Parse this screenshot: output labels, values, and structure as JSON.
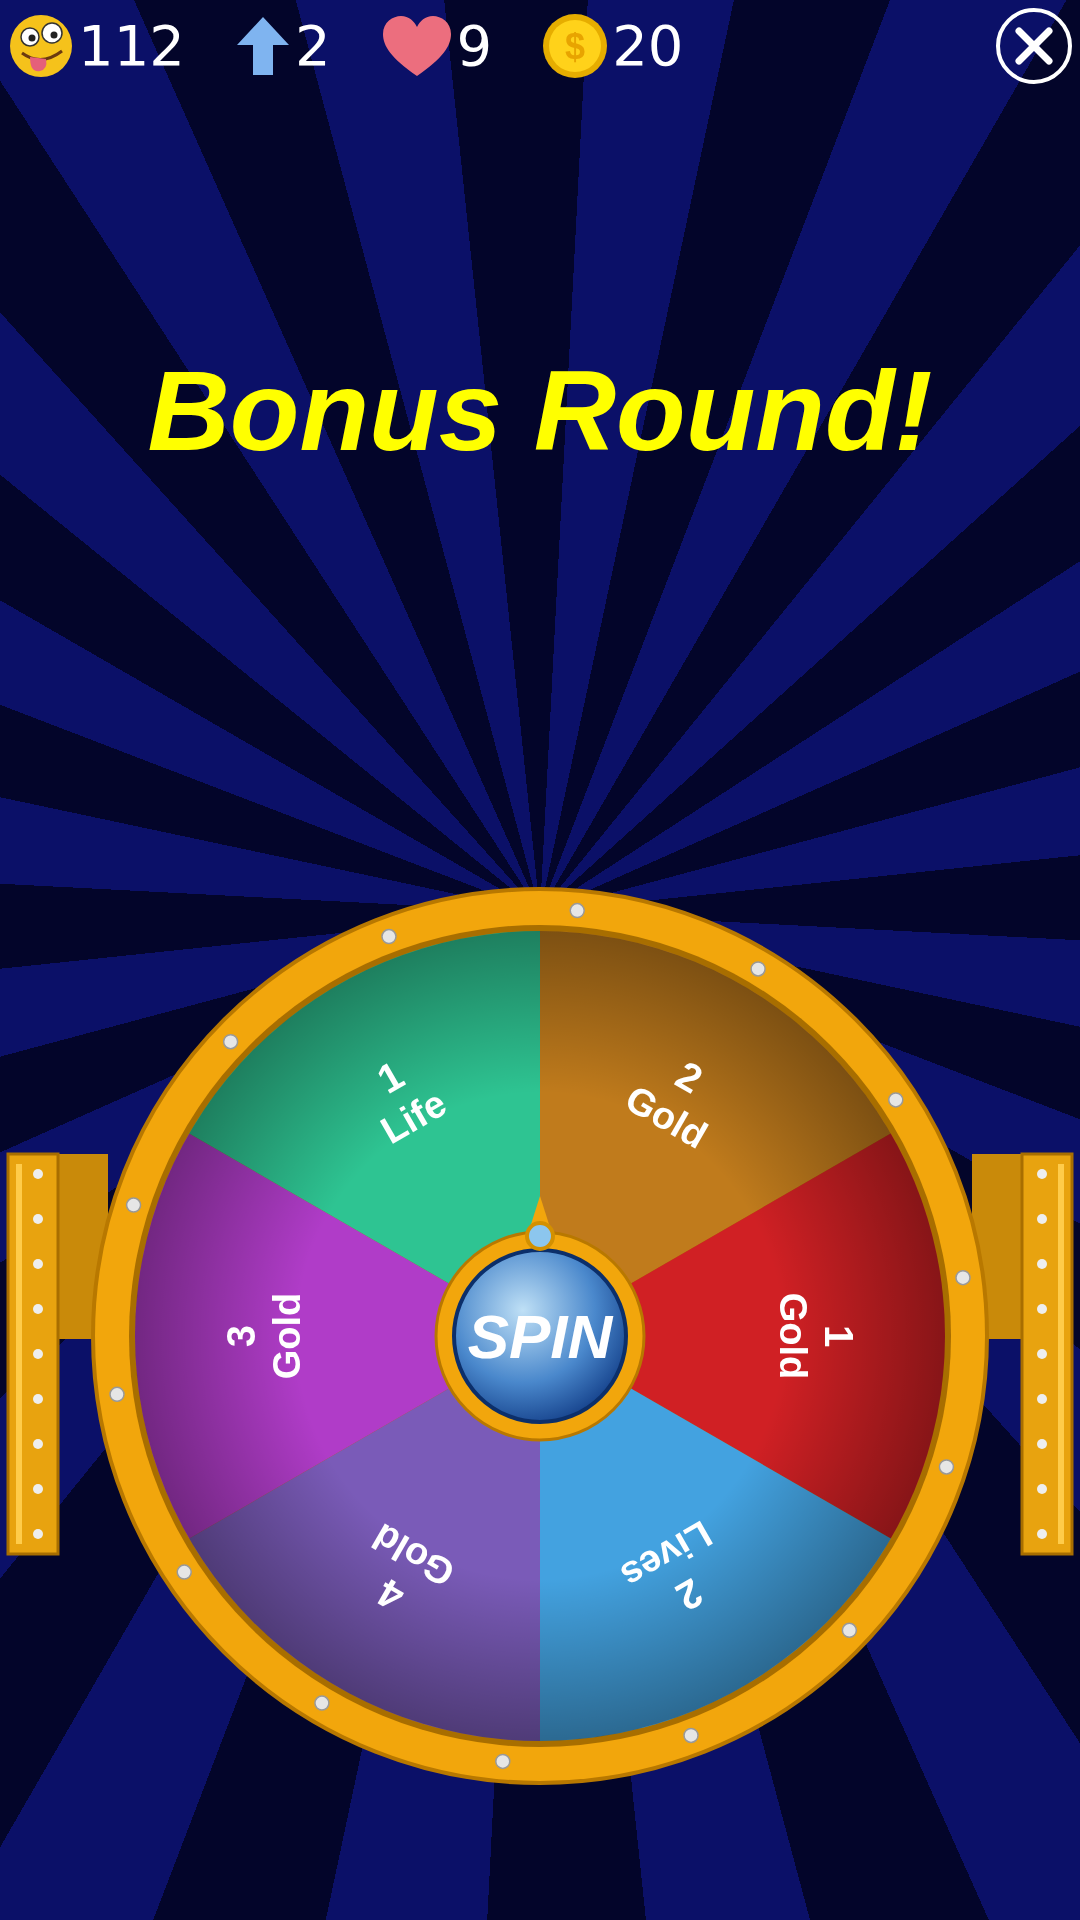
{
  "stats": [
    {
      "kind": "smiles",
      "value": "112"
    },
    {
      "kind": "arrows",
      "value": "2"
    },
    {
      "kind": "lives",
      "value": "9"
    },
    {
      "kind": "coins",
      "value": "20",
      "symbol": "$"
    }
  ],
  "title": "Bonus Round!",
  "wheel": {
    "segments": [
      {
        "amount": "2",
        "prize": "Gold",
        "color": "#c07b1c"
      },
      {
        "amount": "1",
        "prize": "Gold",
        "color": "#d02024"
      },
      {
        "amount": "2",
        "prize": "Lives",
        "color": "#43a2e0"
      },
      {
        "amount": "4",
        "prize": "Gold",
        "color": "#7a5bb8"
      },
      {
        "amount": "3",
        "prize": "Gold",
        "color": "#b03cc8"
      },
      {
        "amount": "1",
        "prize": "Life",
        "color": "#2ec492"
      }
    ],
    "spin_label": "SPIN"
  }
}
